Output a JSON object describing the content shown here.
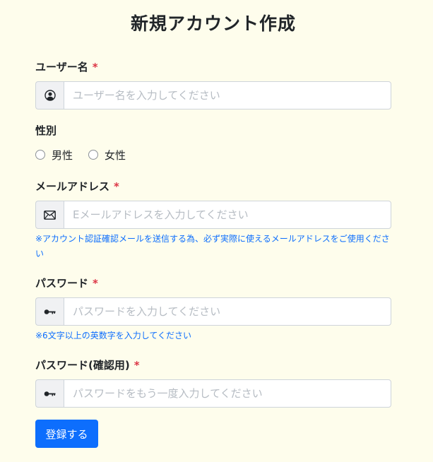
{
  "form": {
    "title": "新規アカウント作成",
    "required_mark": "*",
    "username": {
      "label": "ユーザー名",
      "placeholder": "ユーザー名を入力してください",
      "icon": "person-circle-icon"
    },
    "gender": {
      "label": "性別",
      "options": [
        {
          "label": "男性",
          "selected": false
        },
        {
          "label": "女性",
          "selected": false
        }
      ]
    },
    "email": {
      "label": "メールアドレス",
      "placeholder": "Eメールアドレスを入力してください",
      "icon": "envelope-icon",
      "help": "※アカウント認証確認メールを送信する為、必ず実際に使えるメールアドレスをご使用ください"
    },
    "password": {
      "label": "パスワード",
      "placeholder": "パスワードを入力してください",
      "icon": "key-icon",
      "help": "※6文字以上の英数字を入力してください"
    },
    "password_confirm": {
      "label": "パスワード(確認用)",
      "placeholder": "パスワードをもう一度入力してください",
      "icon": "key-icon"
    },
    "submit_label": "登録する"
  },
  "colors": {
    "background": "#fefdec",
    "primary": "#0d6efd",
    "required": "#dc3545"
  }
}
